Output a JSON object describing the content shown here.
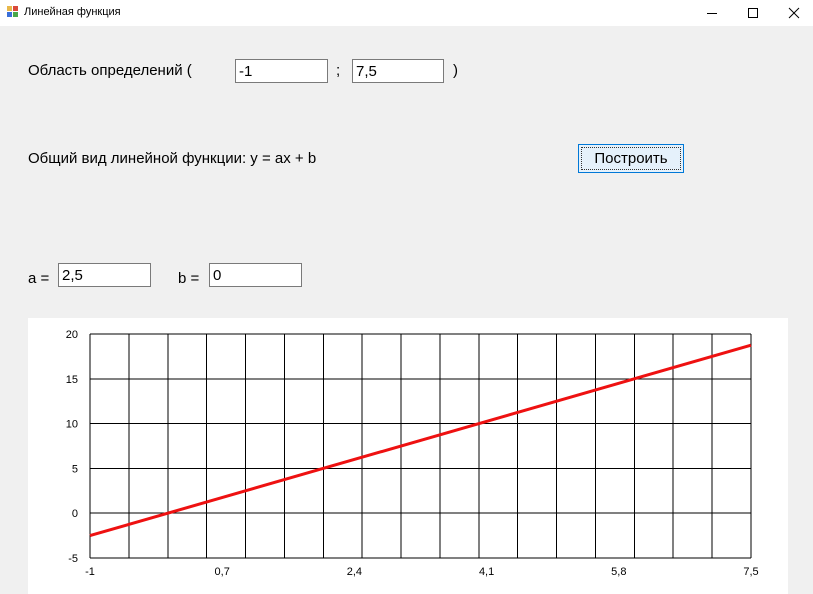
{
  "window": {
    "title": "Линейная функция",
    "controls": {
      "minimize_icon": "minimize-icon",
      "maximize_icon": "maximize-icon",
      "close_icon": "close-icon"
    }
  },
  "form": {
    "domain_label": "Область определений (",
    "separator": ";",
    "close_paren": ")",
    "domain_from": "-1",
    "domain_to": "7,5",
    "general_form_label": "Общий вид линейной функции: y = ax + b",
    "build_button": "Построить",
    "a_label": "a =",
    "a_value": "2,5",
    "b_label": "b =",
    "b_value": "0"
  },
  "chart_data": {
    "type": "line",
    "xlim": [
      -1,
      7.5
    ],
    "ylim": [
      -5,
      20
    ],
    "x_ticks": [
      "-1",
      "0,7",
      "2,4",
      "4,1",
      "5,8",
      "7,5"
    ],
    "y_ticks": [
      "-5",
      "0",
      "5",
      "10",
      "15",
      "20"
    ],
    "grid": true,
    "series": [
      {
        "color": "#ee1111",
        "x": [
          -1,
          7.5
        ],
        "y": [
          -2.5,
          18.75
        ]
      }
    ]
  }
}
